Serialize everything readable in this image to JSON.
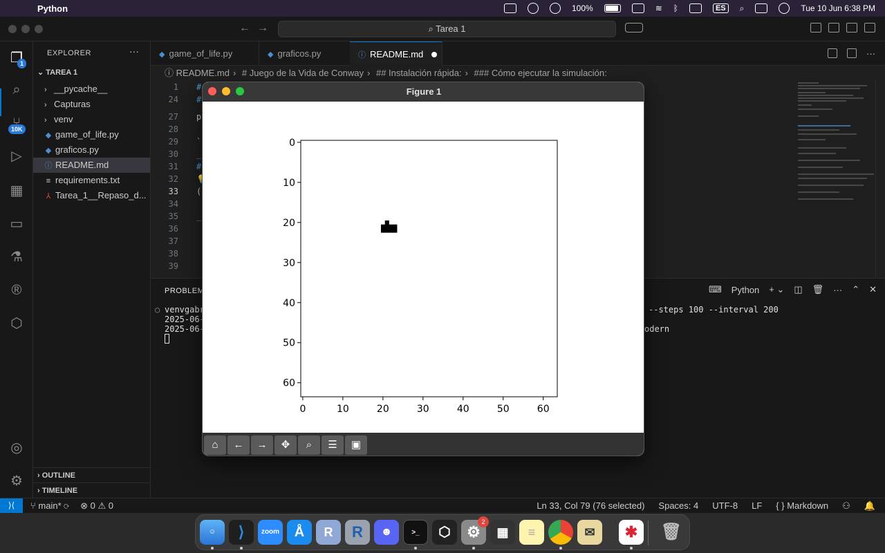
{
  "menubar": {
    "app_name": "Python",
    "battery": "100%",
    "input_lang": "ES",
    "clock": "Tue 10 Jun  6:38 PM"
  },
  "titlebar": {
    "command_center": "Tarea 1"
  },
  "activity": {
    "explorer_badge": "1",
    "scm_badge": "10K"
  },
  "sidebar": {
    "title": "EXPLORER",
    "folder": "TAREA 1",
    "items": [
      {
        "label": "__pycache__",
        "kind": "folder"
      },
      {
        "label": "Capturas",
        "kind": "folder"
      },
      {
        "label": "venv",
        "kind": "folder"
      },
      {
        "label": "game_of_life.py",
        "kind": "python"
      },
      {
        "label": "graficos.py",
        "kind": "python"
      },
      {
        "label": "README.md",
        "kind": "info"
      },
      {
        "label": "requirements.txt",
        "kind": "text"
      },
      {
        "label": "Tarea_1__Repaso_d...",
        "kind": "pdf"
      }
    ],
    "outline": "OUTLINE",
    "timeline": "TIMELINE"
  },
  "tabs": [
    {
      "label": "game_of_life.py"
    },
    {
      "label": "graficos.py"
    },
    {
      "label": "README.md"
    }
  ],
  "breadcrumb": [
    "README.md",
    "# Juego de la Vida de Conway",
    "## Instalación rápida:",
    "### Cómo ejecutar la simulación:"
  ],
  "editor": {
    "line_numbers": [
      "1",
      "24",
      "27",
      "28",
      "29",
      "30",
      "31",
      "32",
      "33",
      "34",
      "35",
      "36",
      "37",
      "38",
      "39"
    ],
    "line_snippets": [
      "#",
      "#",
      "p",
      "`",
      "_",
      "#",
      "💡",
      "(",
      "",
      "_",
      "",
      "",
      "",
      ""
    ]
  },
  "panel": {
    "tab": "PROBLEMS",
    "terminal_label": "Python",
    "lines": [
      "venvgabr",
      "2025-06-",
      "2025-06-"
    ],
    "line_tail_1": "--steps 100 --interval 200",
    "line_tail_3": "odern"
  },
  "status": {
    "branch": "main*",
    "errors": "0",
    "warnings": "0",
    "cursor": "Ln 33, Col 79 (76 selected)",
    "spaces": "Spaces: 4",
    "encoding": "UTF-8",
    "eol": "LF",
    "language": "Markdown"
  },
  "dock": {
    "settings_badge": "2"
  },
  "figure": {
    "title": "Figure 1"
  },
  "chart_data": {
    "type": "heatmap",
    "title": "",
    "xlabel": "",
    "ylabel": "",
    "grid_size": 64,
    "xlim": [
      0,
      63
    ],
    "ylim": [
      63,
      0
    ],
    "x_ticks": [
      0,
      10,
      20,
      30,
      40,
      50,
      60
    ],
    "y_ticks": [
      0,
      10,
      20,
      30,
      40,
      50,
      60
    ],
    "colormap": "binary",
    "live_cells": [
      [
        21,
        20
      ],
      [
        20,
        21
      ],
      [
        21,
        21
      ],
      [
        22,
        21
      ],
      [
        23,
        21
      ],
      [
        20,
        22
      ],
      [
        21,
        22
      ],
      [
        22,
        22
      ],
      [
        23,
        22
      ]
    ]
  }
}
